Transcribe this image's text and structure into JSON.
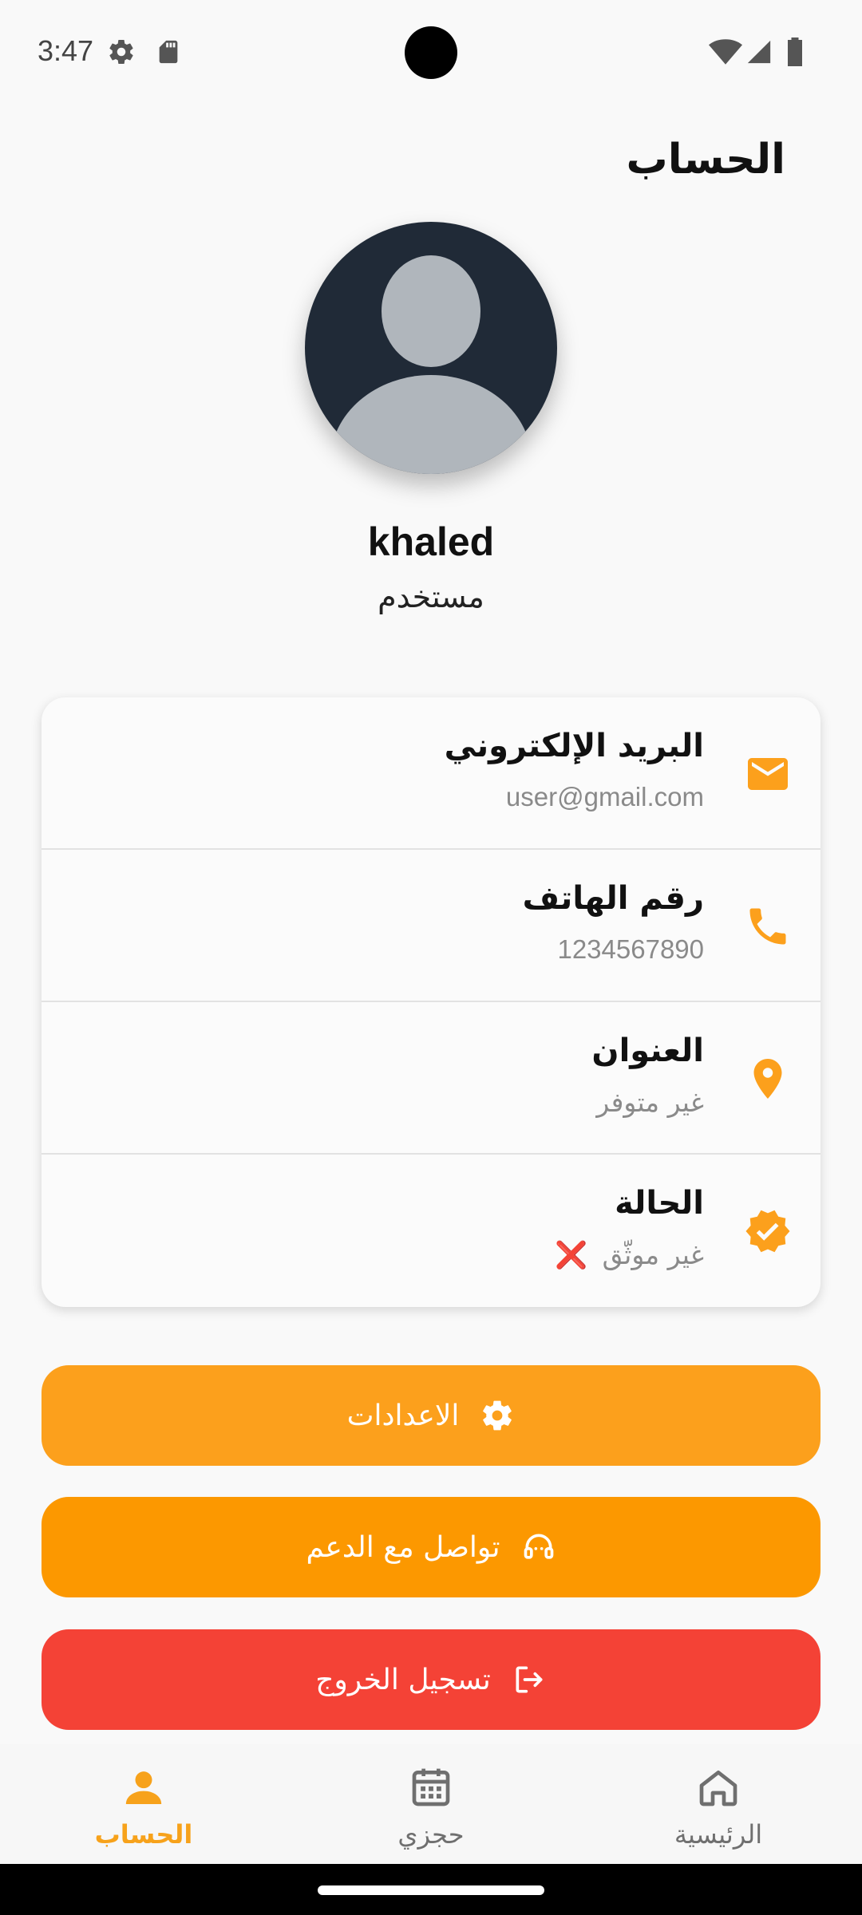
{
  "status_bar": {
    "time": "3:47"
  },
  "header": {
    "title": "الحساب"
  },
  "profile": {
    "name": "khaled",
    "role": "مستخدم"
  },
  "info": [
    {
      "label": "البريد الإلكتروني",
      "value": "user@gmail.com",
      "icon": "email-icon"
    },
    {
      "label": "رقم الهاتف",
      "value": "1234567890",
      "icon": "phone-icon"
    },
    {
      "label": "العنوان",
      "value": "غير متوفر",
      "icon": "location-pin-icon"
    },
    {
      "label": "الحالة",
      "value": "غير موثّق",
      "icon": "verified-badge-icon",
      "status_mark": "❌"
    }
  ],
  "buttons": {
    "settings": "الاعدادات",
    "support": "تواصل مع الدعم",
    "logout": "تسجيل الخروج"
  },
  "nav": {
    "account": "الحساب",
    "bookings": "حجزي",
    "home": "الرئيسية"
  },
  "colors": {
    "accent": "#fca01c",
    "support": "#fc9800",
    "logout": "#f44236",
    "nav_active": "#f7a21b",
    "nav_inactive": "#757575"
  }
}
